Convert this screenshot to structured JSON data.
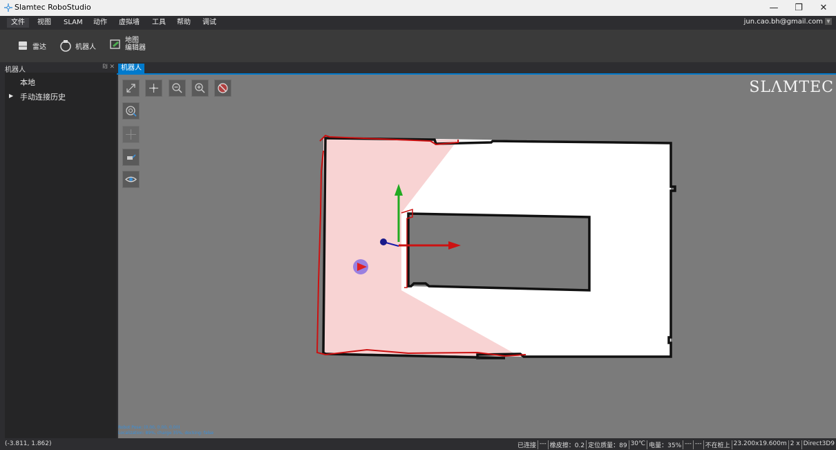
{
  "window": {
    "title": "Slamtec RoboStudio",
    "minimize": "—",
    "restore": "❐",
    "close": "✕"
  },
  "menu": {
    "items": [
      "文件",
      "视图",
      "SLAM",
      "动作",
      "虚拟墙",
      "工具",
      "帮助",
      "调试"
    ],
    "account": "jun.cao.bh@gmail.com"
  },
  "ribbon": {
    "lidar": "雷达",
    "robot": "机器人",
    "map_editor_line1": "地图",
    "map_editor_line2": "编辑器"
  },
  "left_panel": {
    "title": "机器人",
    "controls": "₪ ✕",
    "local": "本地",
    "history": "手动连接历史",
    "history_arrow": "▶"
  },
  "tab": {
    "label": "机器人"
  },
  "map": {
    "logo": "SLΛMTEC",
    "info_line1": "Robot Pose: (0.00, 0.00, 0.00)",
    "info_line2": "Localization: 89%, charge 35%, docking: false"
  },
  "status": {
    "coords": "(-3.811, 1.862)",
    "connected": "已连接",
    "sep1": "---",
    "rubber": "橡皮擦：0.2",
    "quality": "定位质量：89",
    "temp": "30℃",
    "battery": "电量：35%",
    "sep2": "---",
    "sep3": "---",
    "dock": "不在桩上",
    "map_size": "23.200x19.600m",
    "zoom": "2 x",
    "renderer": "Direct3D9"
  },
  "colors": {
    "accent": "#007acc",
    "red_path": "#cc1111",
    "robot": "#9a80e0",
    "axis_x": "#cc1111",
    "axis_y": "#22aa22"
  }
}
